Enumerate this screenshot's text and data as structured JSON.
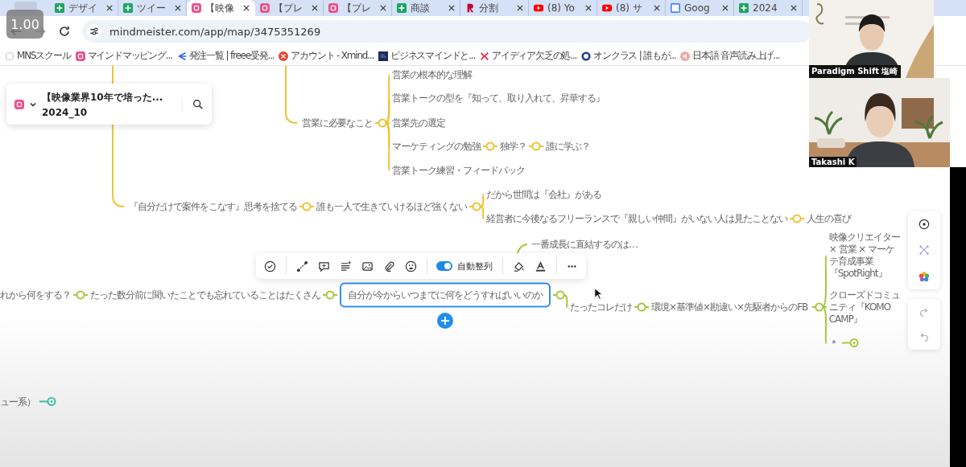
{
  "browser": {
    "speed_badge": "1.00",
    "tabs": [
      {
        "label": "デザイ",
        "kind": "sheet",
        "selected": false
      },
      {
        "label": "ツイー",
        "kind": "sheet",
        "selected": false
      },
      {
        "label": "【映像",
        "kind": "pink",
        "selected": true
      },
      {
        "label": "【プレ",
        "kind": "pink",
        "selected": false
      },
      {
        "label": "【プレ",
        "kind": "pink",
        "selected": false
      },
      {
        "label": "商談",
        "kind": "sheet",
        "selected": false
      },
      {
        "label": "分割",
        "kind": "r",
        "selected": false
      },
      {
        "label": "(8) Yo",
        "kind": "play",
        "selected": false
      },
      {
        "label": "(8) サ",
        "kind": "play",
        "selected": false
      },
      {
        "label": "Goog",
        "kind": "calendar",
        "selected": false
      },
      {
        "label": "2024",
        "kind": "sheet",
        "selected": false
      }
    ],
    "url": "mindmeister.com/app/map/3475351269",
    "bookmarks": [
      {
        "label": "MNSスクール",
        "kind": "blank"
      },
      {
        "label": "マインドマッピング...",
        "kind": "pink"
      },
      {
        "label": "発注一覧 | freee受発...",
        "kind": "arrow"
      },
      {
        "label": "アカウント - Xmind...",
        "kind": "redcircle"
      },
      {
        "label": "ビジネスマインドと...",
        "kind": "navy"
      },
      {
        "label": "アイディア欠乏の処...",
        "kind": "k"
      },
      {
        "label": "オンクラス | 誰もが...",
        "kind": "ring"
      },
      {
        "label": "日本語 音声読み上げ...",
        "kind": "speaker"
      }
    ]
  },
  "video_tiles": [
    {
      "name": "Paradigm Shift 塩崎"
    },
    {
      "name": "Takashi K"
    }
  ],
  "map": {
    "title": "【映像業界10年で培った...",
    "subtitle": "2024_10",
    "branches": [
      {
        "color": "#efc233",
        "node": {
          "text": "営業に必要なこと",
          "selected": false,
          "collapsed": false,
          "children": [
            {
              "text": "営業の根本的な理解",
              "selected": false,
              "collapsed": false
            },
            {
              "text": "営業トークの型を『知って、取り入れて、昇華する』",
              "selected": false,
              "collapsed": false
            },
            {
              "text": "営業先の選定",
              "selected": false,
              "collapsed": false
            },
            {
              "text": "マーケティングの勉強",
              "selected": false,
              "collapsed": false,
              "children": [
                {
                  "text": "独学？",
                  "selected": false,
                  "collapsed": false,
                  "children": [
                    {
                      "text": "誰に学ぶ？",
                      "selected": false,
                      "collapsed": false
                    }
                  ]
                }
              ]
            },
            {
              "text": "営業トーク練習・フィードバック",
              "selected": false,
              "collapsed": false
            }
          ]
        }
      },
      {
        "color": "#efc233",
        "node": {
          "text": "『自分だけで案件をこなす』思考を捨てる",
          "selected": false,
          "collapsed": false,
          "children": [
            {
              "text": "誰も一人で生きていけるほど強くない",
              "selected": false,
              "collapsed": false,
              "children": [
                {
                  "text": "だから世間は『会社』がある",
                  "selected": false,
                  "collapsed": false
                },
                {
                  "text": "経営者に今後なるフリーランスで『親しい仲間』がいない人は見たことない",
                  "selected": false,
                  "collapsed": false,
                  "children": [
                    {
                      "text": "人生の喜び",
                      "selected": false,
                      "collapsed": false
                    }
                  ]
                }
              ]
            }
          ]
        }
      },
      {
        "color": "#a5c83c",
        "node": {
          "text": "一番成長に直結するのは…",
          "selected": false,
          "collapsed": false
        }
      },
      {
        "color": "#a5c83c",
        "node": {
          "text": "れから何をする？",
          "selected": false,
          "collapsed": false,
          "children": [
            {
              "text": "たった数分前に聞いたことでも忘れていることはたくさん",
              "selected": false,
              "collapsed": false,
              "children": [
                {
                  "text": "自分が今からいつまでに何をどうすればいいのか",
                  "selected": true,
                  "collapsed": false,
                  "children": [
                    {
                      "text": "たったコレだけ",
                      "selected": false,
                      "collapsed": false,
                      "children": [
                        {
                          "text": "環境×基準値×勘違い×先駆者からのFB",
                          "selected": false,
                          "collapsed": false,
                          "children": [
                            {
                              "text": "映像クリエイター × 営業 × マーケテ育成事業『SpotRight』",
                              "selected": false,
                              "collapsed": false
                            },
                            {
                              "text": "クローズドコミュニティ『KOMO CAMP』",
                              "selected": false,
                              "collapsed": false
                            },
                            {
                              "text": "＊",
                              "selected": false,
                              "collapsed": true
                            }
                          ]
                        }
                      ]
                    }
                  ]
                }
              ]
            }
          ]
        }
      },
      {
        "color": "#3dbda5",
        "node": {
          "text": "ュー系）",
          "selected": false,
          "collapsed": true
        }
      }
    ]
  },
  "toolbar": {
    "toggle": {
      "label": "自動整列",
      "on": true
    }
  }
}
